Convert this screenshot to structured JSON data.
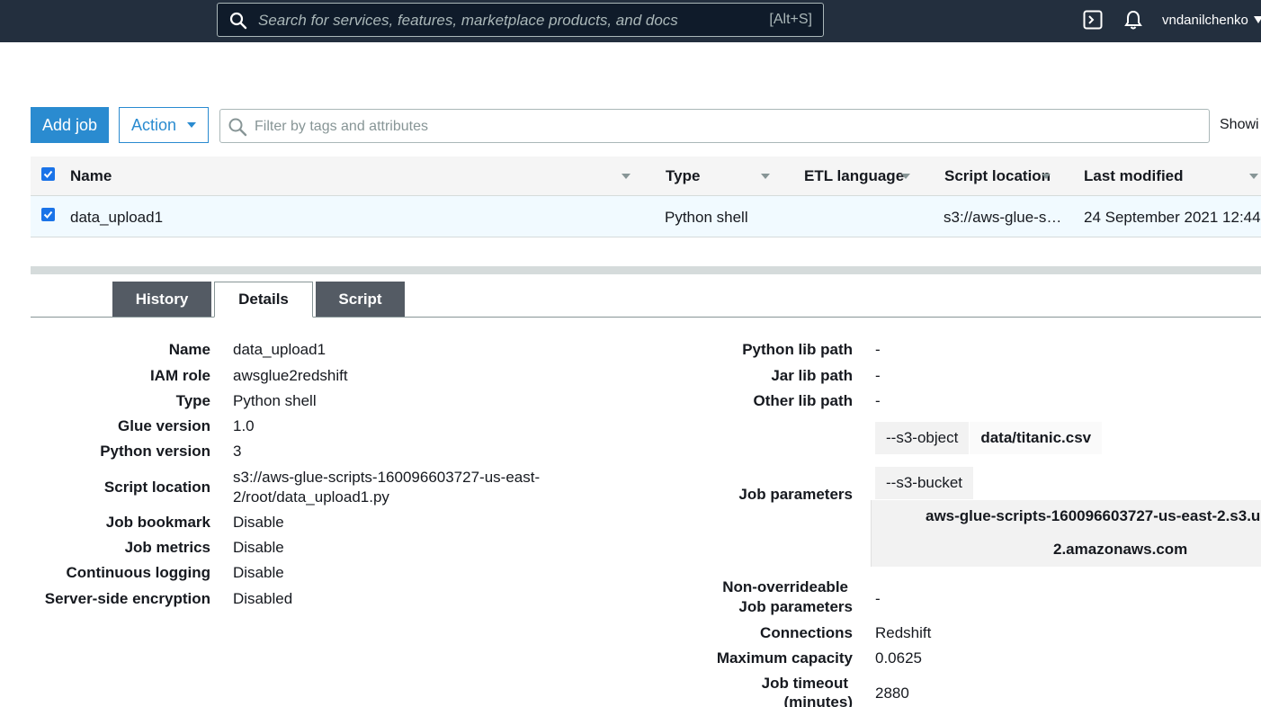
{
  "header": {
    "search_placeholder": "Search for services, features, marketplace products, and docs",
    "search_shortcut": "[Alt+S]",
    "username": "vndanilchenko"
  },
  "toolbar": {
    "add_job_label": "Add job",
    "action_label": "Action",
    "filter_placeholder": "Filter by tags and attributes",
    "showing_label": "Showi"
  },
  "table": {
    "columns": [
      "Name",
      "Type",
      "ETL language",
      "Script location",
      "Last modified"
    ],
    "rows": [
      {
        "name": "data_upload1",
        "type": "Python shell",
        "etl_language": "",
        "script_location": "s3://aws-glue-s…",
        "last_modified": "24 September 2021 12:44"
      }
    ]
  },
  "tabs": [
    "History",
    "Details",
    "Script"
  ],
  "details": {
    "left": [
      {
        "label": "Name",
        "value": "data_upload1"
      },
      {
        "label": "IAM role",
        "value": "awsglue2redshift"
      },
      {
        "label": "Type",
        "value": "Python shell"
      },
      {
        "label": "Glue version",
        "value": "1.0"
      },
      {
        "label": "Python version",
        "value": "3"
      },
      {
        "label": "Script location",
        "value_line1": "s3://aws-glue-scripts-160096603727-us-east-",
        "value_line2": "2/root/data_upload1.py"
      },
      {
        "label": "Job bookmark",
        "value": "Disable"
      },
      {
        "label": "Job metrics",
        "value": "Disable"
      },
      {
        "label": "Continuous logging",
        "value": "Disable"
      },
      {
        "label": "Server-side encryption",
        "value": "Disabled"
      }
    ],
    "right": {
      "python_lib_path": {
        "label": "Python lib path",
        "value": "-"
      },
      "jar_lib_path": {
        "label": "Jar lib path",
        "value": "-"
      },
      "other_lib_path": {
        "label": "Other lib path",
        "value": "-"
      },
      "job_parameters": {
        "label": "Job parameters",
        "params": [
          {
            "key": "--s3-object",
            "value": "data/titanic.csv"
          },
          {
            "key": "--s3-bucket",
            "value_line1": "aws-glue-scripts-160096603727-us-east-2.s3.u",
            "value_line2": "2.amazonaws.com"
          }
        ]
      },
      "non_overrideable": {
        "label_line1": "Non-overrideable",
        "label_line2": "Job parameters",
        "value": "-"
      },
      "connections": {
        "label": "Connections",
        "value": "Redshift"
      },
      "max_capacity": {
        "label": "Maximum capacity",
        "value": "0.0625"
      },
      "job_timeout": {
        "label_line1": "Job timeout",
        "label_line2": "(minutes)",
        "value": "2880"
      }
    }
  }
}
